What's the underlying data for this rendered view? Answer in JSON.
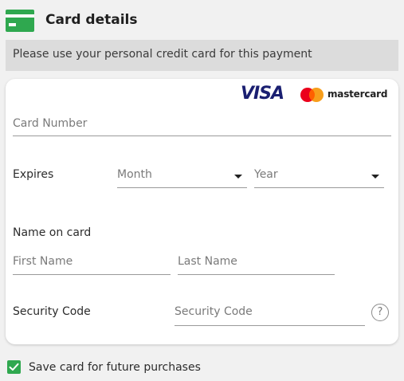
{
  "header": {
    "title": "Card details",
    "icon": "credit-card-icon",
    "icon_color": "#2fa84f"
  },
  "notice": {
    "text": "Please use your personal credit card for this payment"
  },
  "brands": {
    "visa": "VISA",
    "visa_color": "#1a1f71",
    "mastercard": "mastercard",
    "mastercard_colors": [
      "#eb001b",
      "#f79e1b"
    ]
  },
  "form": {
    "card_number": {
      "placeholder": "Card Number"
    },
    "expires": {
      "label": "Expires",
      "month": {
        "selected": "Month"
      },
      "year": {
        "selected": "Year"
      }
    },
    "name_on_card": {
      "label": "Name on card",
      "first_name": {
        "placeholder": "First Name"
      },
      "last_name": {
        "placeholder": "Last Name"
      }
    },
    "security_code": {
      "label": "Security Code",
      "placeholder": "Security Code",
      "help_icon": "question-icon",
      "help_symbol": "?"
    }
  },
  "save_card": {
    "label": "Save card for future purchases",
    "checked": true,
    "check_color": "#2fa84f"
  }
}
